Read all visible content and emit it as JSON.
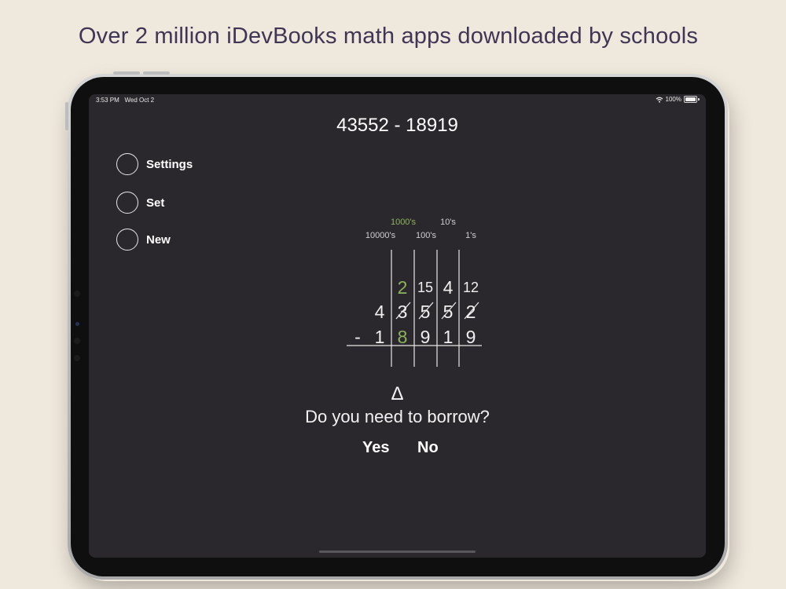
{
  "headline": "Over 2 million iDevBooks math apps downloaded by schools",
  "status_bar": {
    "time": "3:53 PM",
    "date": "Wed Oct 2",
    "battery": "100%"
  },
  "problem": "43552 - 18919",
  "menu": [
    {
      "label": "Settings"
    },
    {
      "label": "Set"
    },
    {
      "label": "New"
    }
  ],
  "place_values": {
    "thousands": "1000's",
    "tens": "10's",
    "ten_thousands": "10000's",
    "hundreds": "100's",
    "ones": "1's"
  },
  "borrow_row": [
    "2",
    "15",
    "4",
    "12"
  ],
  "minuend": [
    "4",
    "3",
    "5",
    "5",
    "2"
  ],
  "subtrahend_sign": "-",
  "subtrahend": [
    "1",
    "8",
    "9",
    "1",
    "9"
  ],
  "hint_icon": "Δ",
  "prompt": "Do you need to borrow?",
  "answers": {
    "yes": "Yes",
    "no": "No"
  },
  "colors": {
    "background": "#efe8dc",
    "headline": "#3f3555",
    "screen": "#2b282d",
    "highlight_green": "#8bb35c"
  }
}
